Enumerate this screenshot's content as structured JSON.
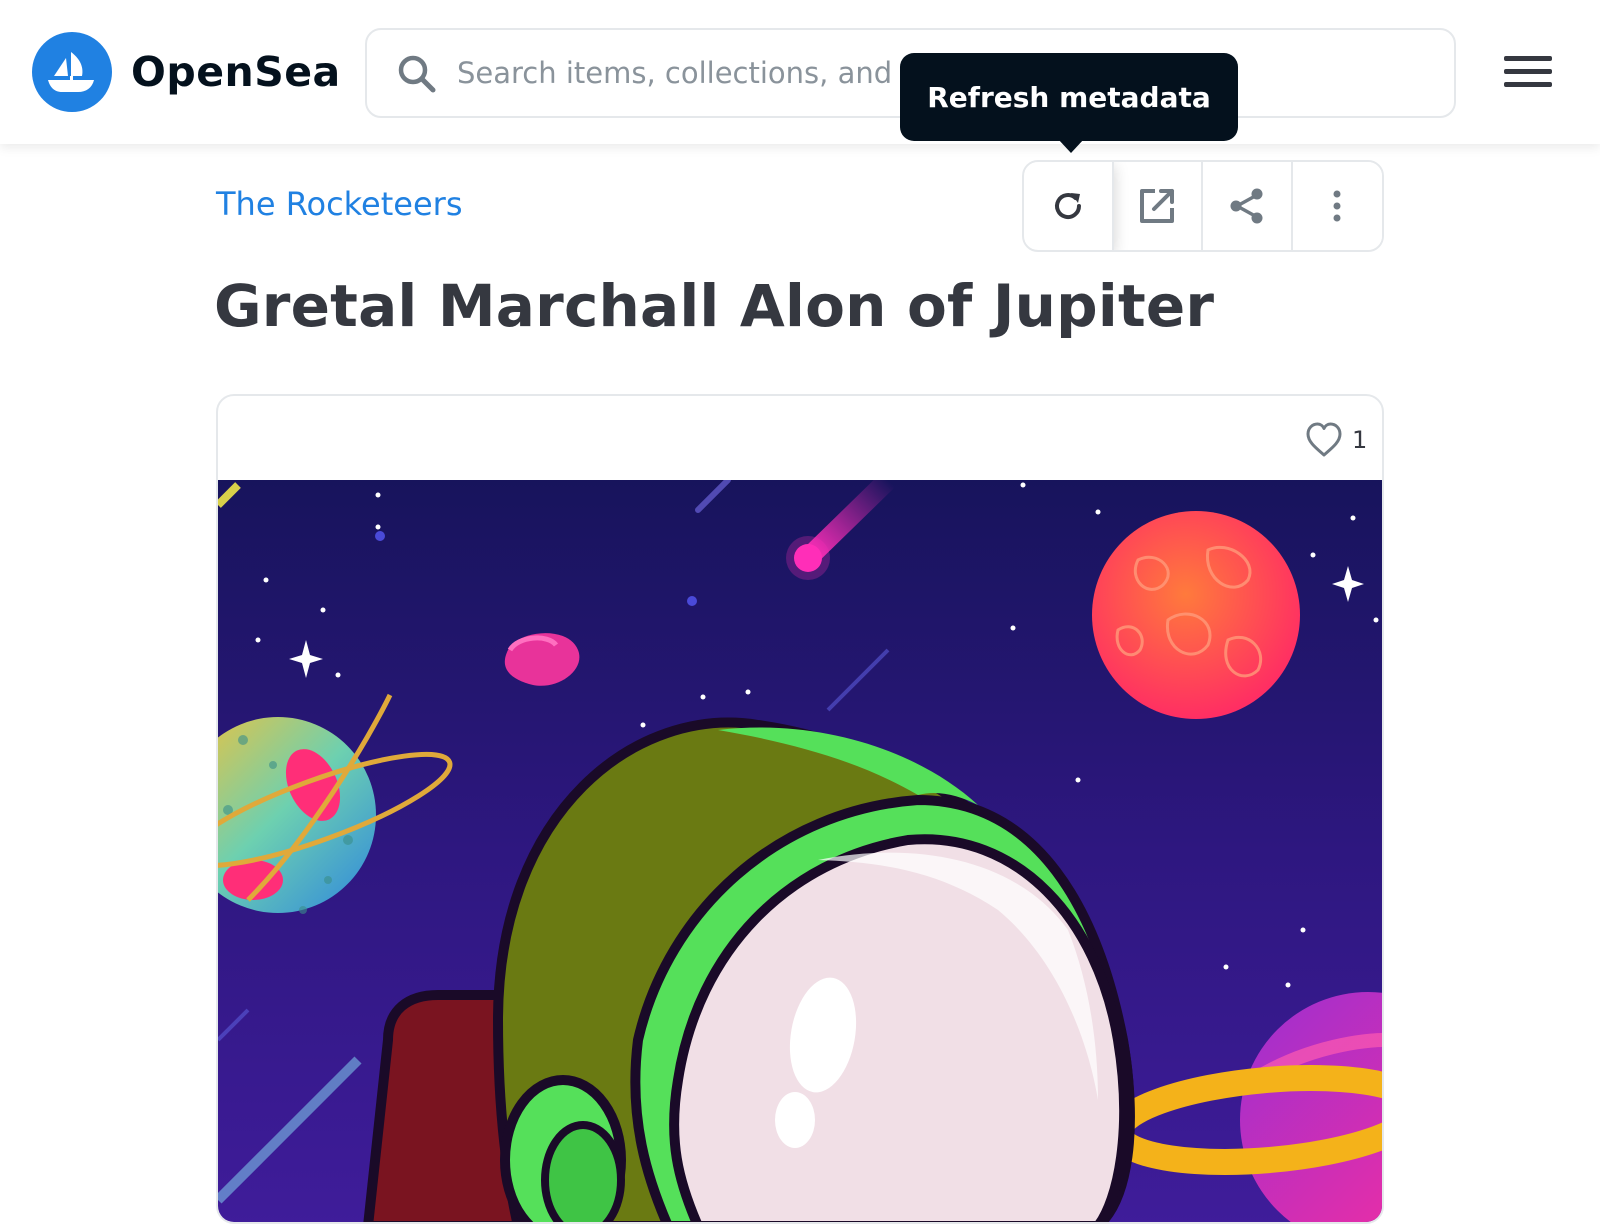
{
  "header": {
    "brand_name": "OpenSea",
    "search_placeholder": "Search items, collections, and accounts",
    "brand_color": "#2081e2"
  },
  "tooltip": {
    "text": "Refresh metadata"
  },
  "asset": {
    "collection_name": "The Rocketeers",
    "title": "Gretal Marchall Alon of Jupiter",
    "like_count": "1"
  },
  "actions": [
    {
      "icon": "refresh-icon"
    },
    {
      "icon": "external-link-icon"
    },
    {
      "icon": "share-icon"
    },
    {
      "icon": "more-vertical-icon"
    }
  ]
}
